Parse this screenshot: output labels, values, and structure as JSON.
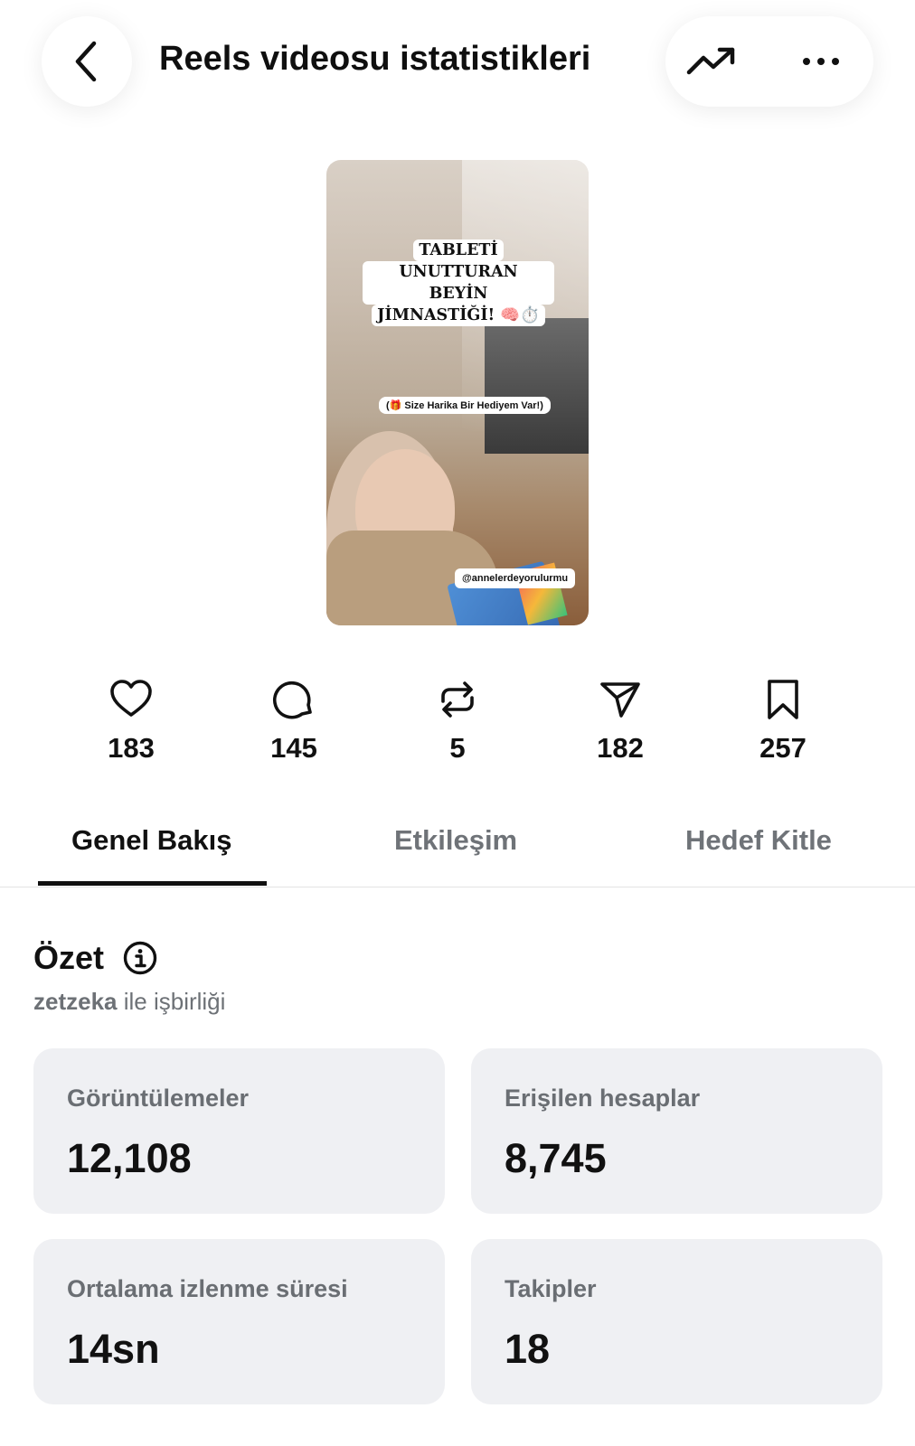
{
  "header": {
    "title": "Reels videosu istatistikleri"
  },
  "icons": {
    "back": "chevron-left-icon",
    "trend": "trending-up-icon",
    "more": "more-horizontal-icon",
    "like": "heart-icon",
    "comment": "comment-icon",
    "repost": "repost-icon",
    "share": "send-icon",
    "save": "bookmark-icon",
    "info": "info-icon"
  },
  "thumbnail": {
    "caption_lines": [
      "TABLETİ",
      "UNUTTURAN BEYİN",
      "JİMNASTİĞİ! 🧠⏱️"
    ],
    "sticker": "(🎁 Size Harika Bir Hediyem Var!)",
    "handle": "@annelerdeyorulurmu"
  },
  "metrics": [
    {
      "name": "likes",
      "count": "183"
    },
    {
      "name": "comments",
      "count": "145"
    },
    {
      "name": "reposts",
      "count": "5"
    },
    {
      "name": "shares",
      "count": "182"
    },
    {
      "name": "saves",
      "count": "257"
    }
  ],
  "tabs": [
    {
      "label": "Genel Bakış",
      "active": true
    },
    {
      "label": "Etkileşim",
      "active": false
    },
    {
      "label": "Hedef Kitle",
      "active": false
    }
  ],
  "summary": {
    "title": "Özet",
    "collab_user": "zetzeka",
    "collab_suffix": " ile işbirliği",
    "cards": [
      {
        "label": "Görüntülemeler",
        "value": "12,108"
      },
      {
        "label": "Erişilen hesaplar",
        "value": "8,745"
      },
      {
        "label": "Ortalama izlenme süresi",
        "value": "14sn"
      },
      {
        "label": "Takipler",
        "value": "18"
      }
    ]
  },
  "colors": {
    "card_bg": "#eff0f3",
    "muted_text": "#6f7378",
    "primary_text": "#111111"
  }
}
